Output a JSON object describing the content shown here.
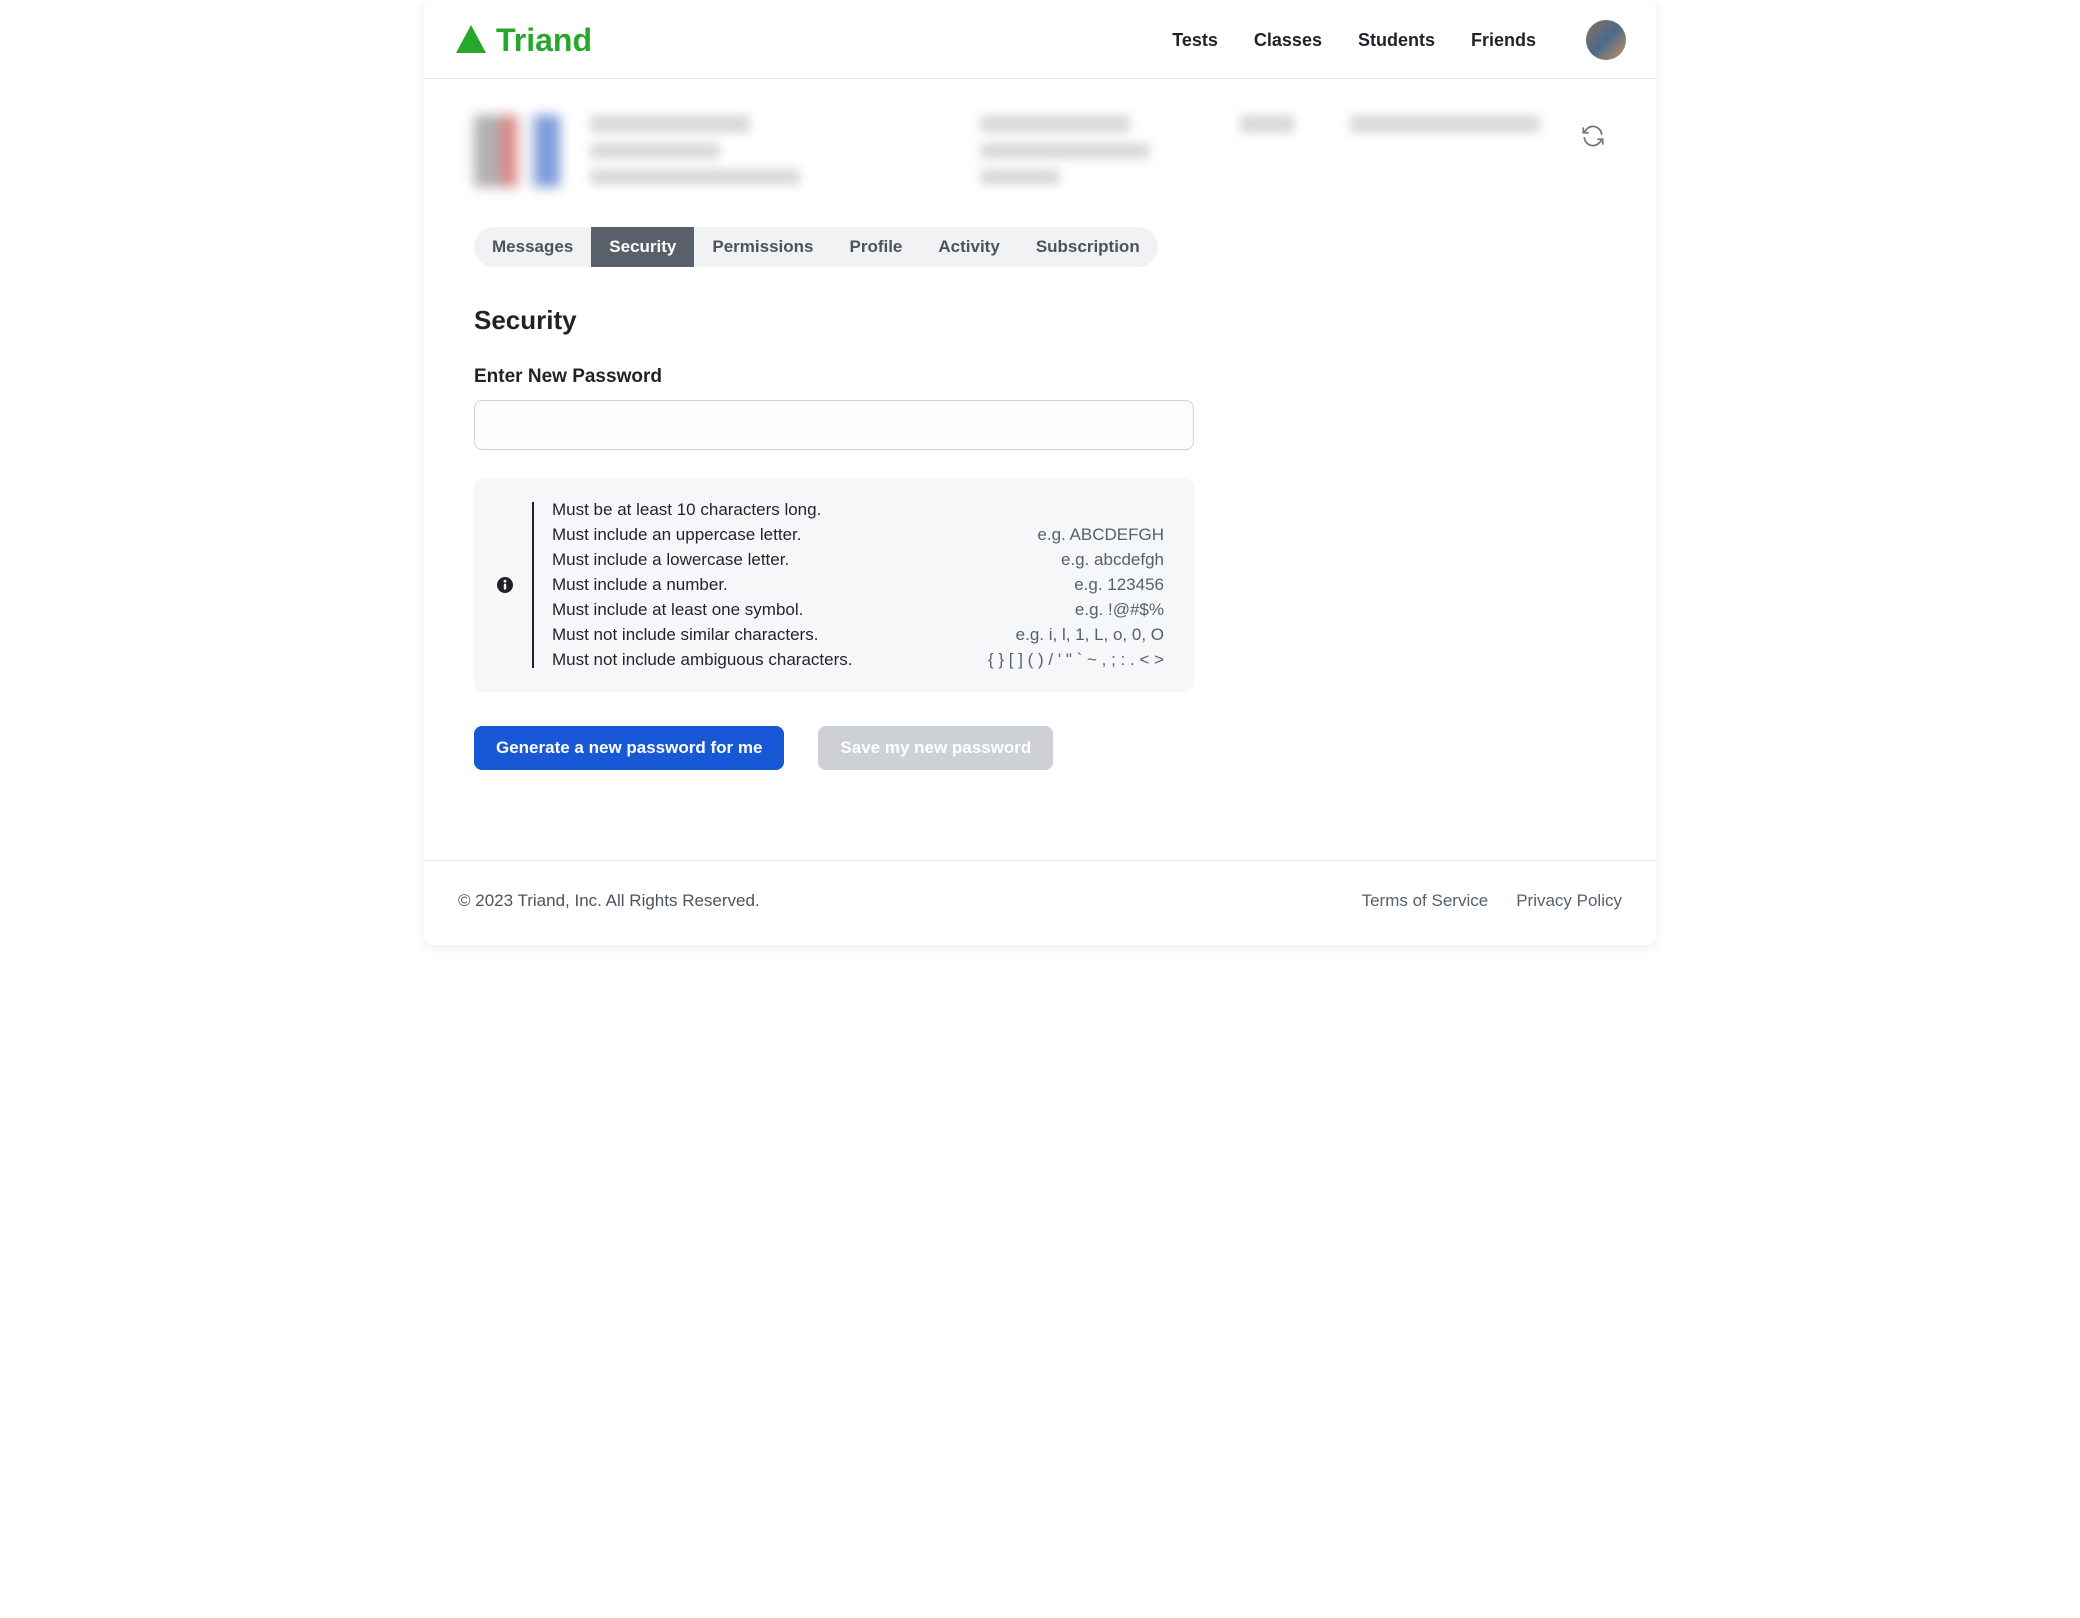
{
  "brand": {
    "name": "Triand"
  },
  "nav": {
    "tests": "Tests",
    "classes": "Classes",
    "students": "Students",
    "friends": "Friends"
  },
  "tabs": {
    "messages": "Messages",
    "security": "Security",
    "permissions": "Permissions",
    "profile": "Profile",
    "activity": "Activity",
    "subscription": "Subscription"
  },
  "security": {
    "heading": "Security",
    "password_label": "Enter New Password",
    "password_value": "",
    "rules": [
      {
        "text": "Must be at least 10 characters long.",
        "example": ""
      },
      {
        "text": "Must include an uppercase letter.",
        "example": "e.g. ABCDEFGH"
      },
      {
        "text": "Must include a lowercase letter.",
        "example": "e.g. abcdefgh"
      },
      {
        "text": "Must include a number.",
        "example": "e.g. 123456"
      },
      {
        "text": "Must include at least one symbol.",
        "example": "e.g. !@#$%"
      },
      {
        "text": "Must not include similar characters.",
        "example": "e.g. i, l, 1, L, o, 0, O"
      },
      {
        "text": "Must not include ambiguous characters.",
        "example": "{ } [ ] ( ) / ' \" ` ~ , ; : . < >"
      }
    ],
    "generate_btn": "Generate a new password for me",
    "save_btn": "Save my new password"
  },
  "footer": {
    "copyright": "© 2023  Triand, Inc. All Rights Reserved.",
    "terms": "Terms of Service",
    "privacy": "Privacy Policy"
  }
}
